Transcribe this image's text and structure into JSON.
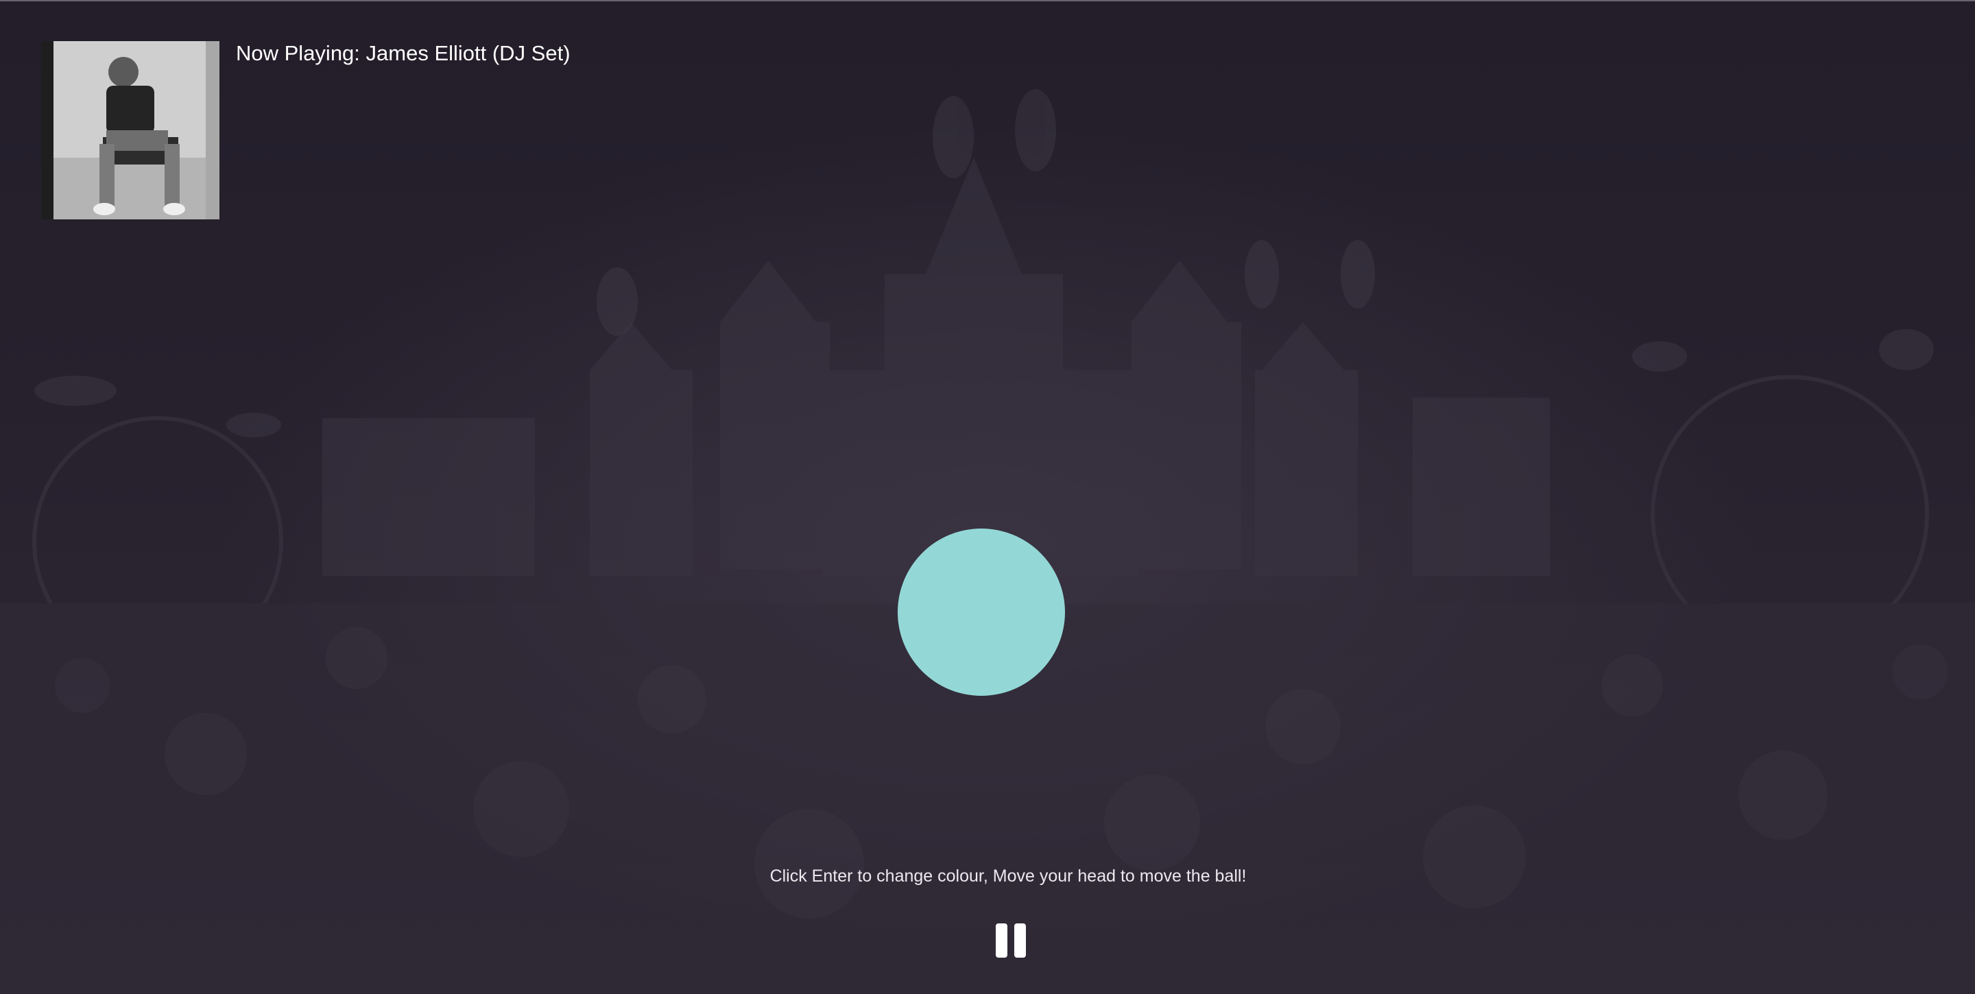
{
  "now_playing": {
    "title": "Now Playing: James Elliott (DJ Set)"
  },
  "ball": {
    "color": "#93d8d6"
  },
  "instructions": {
    "text": "Click Enter to change colour, Move your head to move the ball!"
  },
  "controls": {
    "pause_icon": "pause-icon"
  },
  "colors": {
    "background": "#241f2b",
    "text": "#ffffff"
  }
}
